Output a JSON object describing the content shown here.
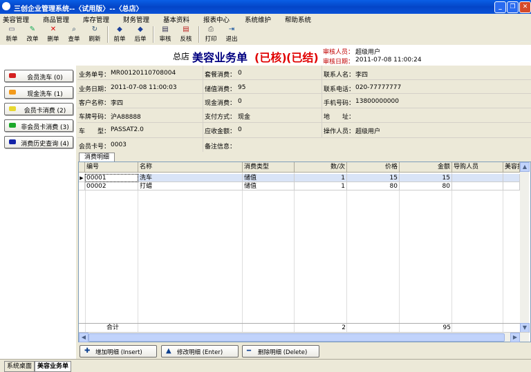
{
  "window": {
    "title": "三创企业管理系统--〈试用版〉--〈总店〉"
  },
  "menu": [
    "美容管理",
    "商品管理",
    "库存管理",
    "财务管理",
    "基本资料",
    "报表中心",
    "系统维护",
    "帮助系统"
  ],
  "toolbar": [
    {
      "label": "新单",
      "icon": "new-doc-icon"
    },
    {
      "label": "改单",
      "icon": "edit-icon"
    },
    {
      "label": "删单",
      "icon": "delete-icon"
    },
    {
      "label": "查单",
      "icon": "search-icon"
    },
    {
      "label": "刷新",
      "icon": "refresh-icon"
    },
    {
      "label": "前单",
      "icon": "prev-icon"
    },
    {
      "label": "后单",
      "icon": "next-icon"
    },
    {
      "label": "审核",
      "icon": "approve-icon"
    },
    {
      "label": "反核",
      "icon": "unapprove-icon"
    },
    {
      "label": "打印",
      "icon": "print-icon"
    },
    {
      "label": "退出",
      "icon": "exit-icon"
    }
  ],
  "header": {
    "store": "总店",
    "bill_type": "美容业务单",
    "status1": "(已核)",
    "status2": "(已结)",
    "auditor_label": "审核人员：",
    "auditor": "超级用户",
    "audit_date_label": "审核日期：",
    "audit_date": "2011-07-08 11:00:24"
  },
  "side_buttons": [
    {
      "label": "会员洗车 (0)",
      "color": "#d42020"
    },
    {
      "label": "现金洗车 (1)",
      "color": "#f39a1a"
    },
    {
      "label": "会员卡消费 (2)",
      "color": "#e8d830"
    },
    {
      "label": "非会员卡消费 (3)",
      "color": "#1ca82a"
    },
    {
      "label": "消费历史查询 (4)",
      "color": "#1424a8"
    }
  ],
  "info": {
    "bill_no_label": "业务单号：",
    "bill_no": "MR00120110708004",
    "set_label": "套餐消费：",
    "set_value": "0",
    "contact_label": "联系人名：",
    "contact": "李四",
    "date_label": "业务日期：",
    "date": "2011-07-08 11:00:03",
    "stored_label": "储值消费：",
    "stored": "95",
    "phone_label": "联系电话：",
    "phone": "020-77777777",
    "customer_label": "客户名称：",
    "customer": "李四",
    "cash_label": "现金消费：",
    "cash": "0",
    "mobile_label": "手机号码：",
    "mobile": "13800000000",
    "plate_label": "车牌号码：",
    "plate": "沪A88888",
    "pay_label": "支付方式：",
    "pay": "现金",
    "addr_label": "地　　址：",
    "addr": "",
    "model_label": "车　　型：",
    "model": "PASSAT2.0",
    "receivable_label": "应收金额：",
    "receivable": "0",
    "operator_label": "操作人员：",
    "operator": "超级用户",
    "card_label": "会员卡号：",
    "card": "0003",
    "note_label": "备注信息：",
    "note": ""
  },
  "tab": "消费明细",
  "grid": {
    "columns": [
      "编号",
      "名称",
      "消费类型",
      "数/次",
      "价格",
      "金额",
      "导购人员",
      "美容技"
    ],
    "rows": [
      [
        "00001",
        "洗车",
        "储值",
        "1",
        "15",
        "15",
        "",
        ""
      ],
      [
        "00002",
        "打蜡",
        "储值",
        "1",
        "80",
        "80",
        "",
        ""
      ]
    ],
    "total_label": "合计",
    "total_qty": "2",
    "total_amount": "95"
  },
  "bottom_buttons": [
    {
      "label": "增加明细 (Insert)",
      "icon": "plus-icon"
    },
    {
      "label": "修改明细 (Enter)",
      "icon": "up-arrow-icon"
    },
    {
      "label": "删除明细 (Delete)",
      "icon": "minus-icon"
    }
  ],
  "bottom_tabs": [
    "系统桌面",
    "美容业务单"
  ]
}
